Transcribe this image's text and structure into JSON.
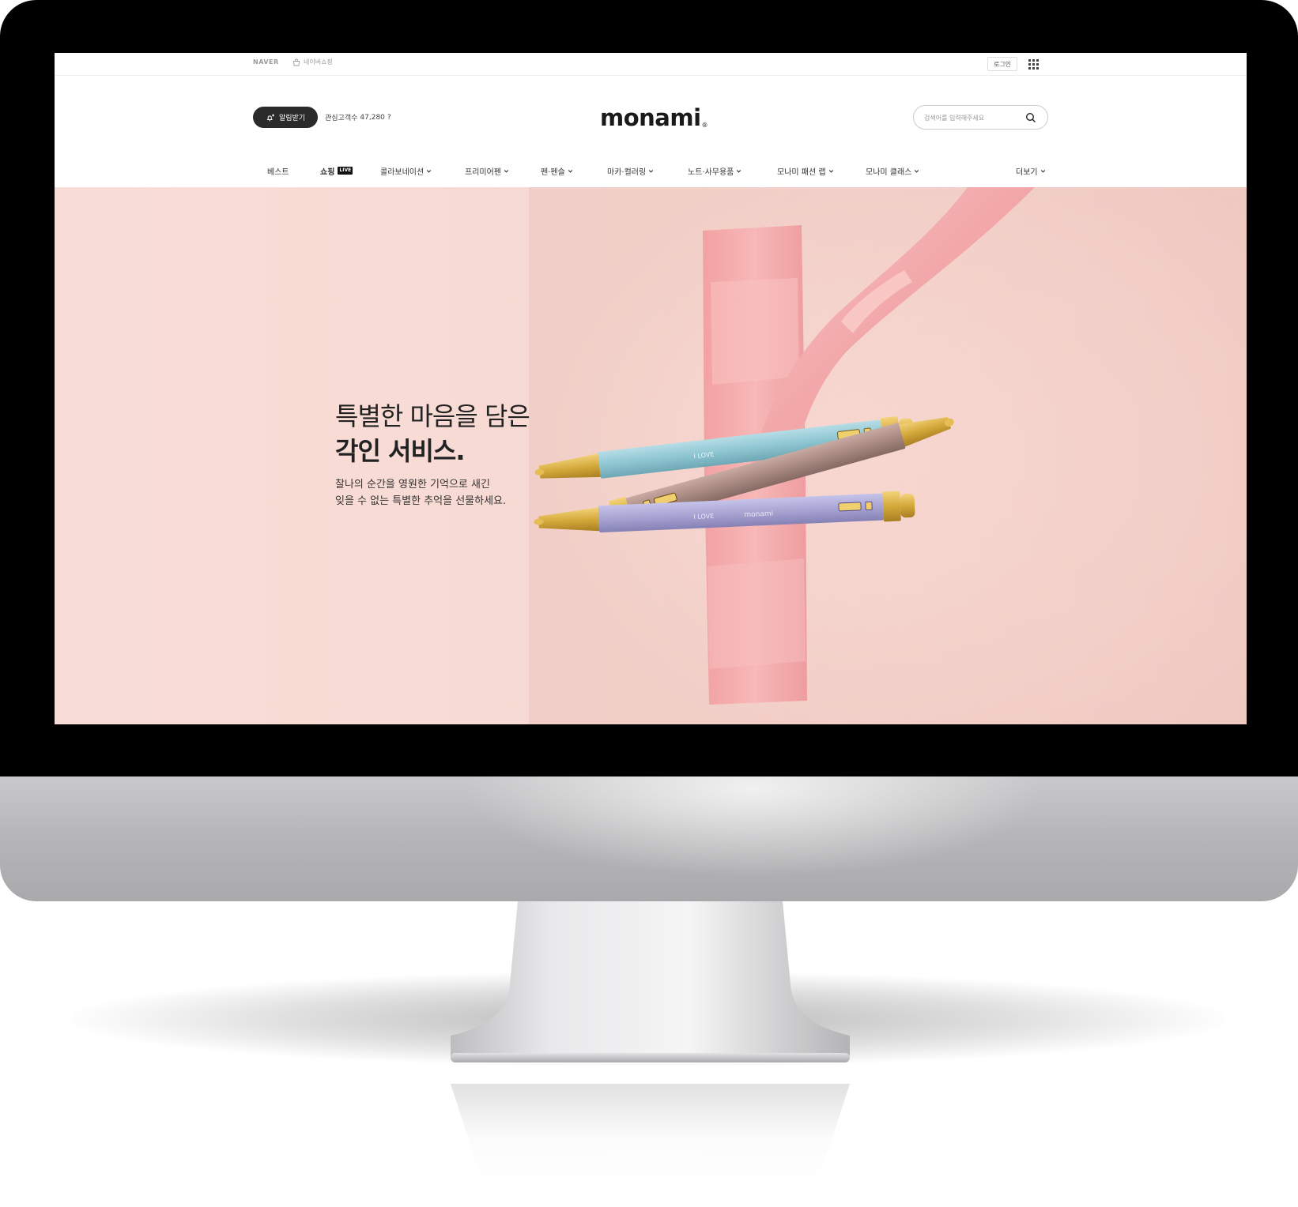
{
  "gnb": {
    "naver_logo": "NAVER",
    "naver_shopping": "네이버쇼핑",
    "login": "로그인",
    "apps_icon": "grid-menu-icon"
  },
  "header": {
    "alarm_button": "알림받기",
    "interest_label": "관심고객수",
    "interest_count": "47,280",
    "interest_help": "?",
    "brand": "monami",
    "brand_mark": "®",
    "search_placeholder": "검색어를 입력해주세요"
  },
  "nav": {
    "items": [
      {
        "label": "베스트"
      },
      {
        "label": "쇼핑",
        "tag": "LIVE"
      },
      {
        "label": "콜라보네이션"
      },
      {
        "label": "프리미어펜"
      },
      {
        "label": "펜·펜슬"
      },
      {
        "label": "마카·컬러링"
      },
      {
        "label": "노트·사무용품"
      },
      {
        "label": "모나미 패션 랩"
      },
      {
        "label": "모나미 클래스"
      }
    ],
    "more": "더보기"
  },
  "hero": {
    "title_line1": "특별한 마음을 담은",
    "title_line2": "각인 서비스.",
    "desc_line1": "찰나의 순간을 영원한 기억으로 새긴",
    "desc_line2": "잊을 수 없는 특별한 추억을 선물하세요.",
    "pen_engraving_1": "I LOVE",
    "pen_engraving_2": "I LOVE",
    "pen_brand": "monami"
  },
  "colors": {
    "hero_bg": "#f7d9d2",
    "ribbon": "#f4a9aa",
    "pen_blue": "#8fc6d2",
    "pen_mauve": "#a88a82",
    "pen_lavender": "#a7a4d2",
    "gold": "#d4a93a"
  }
}
